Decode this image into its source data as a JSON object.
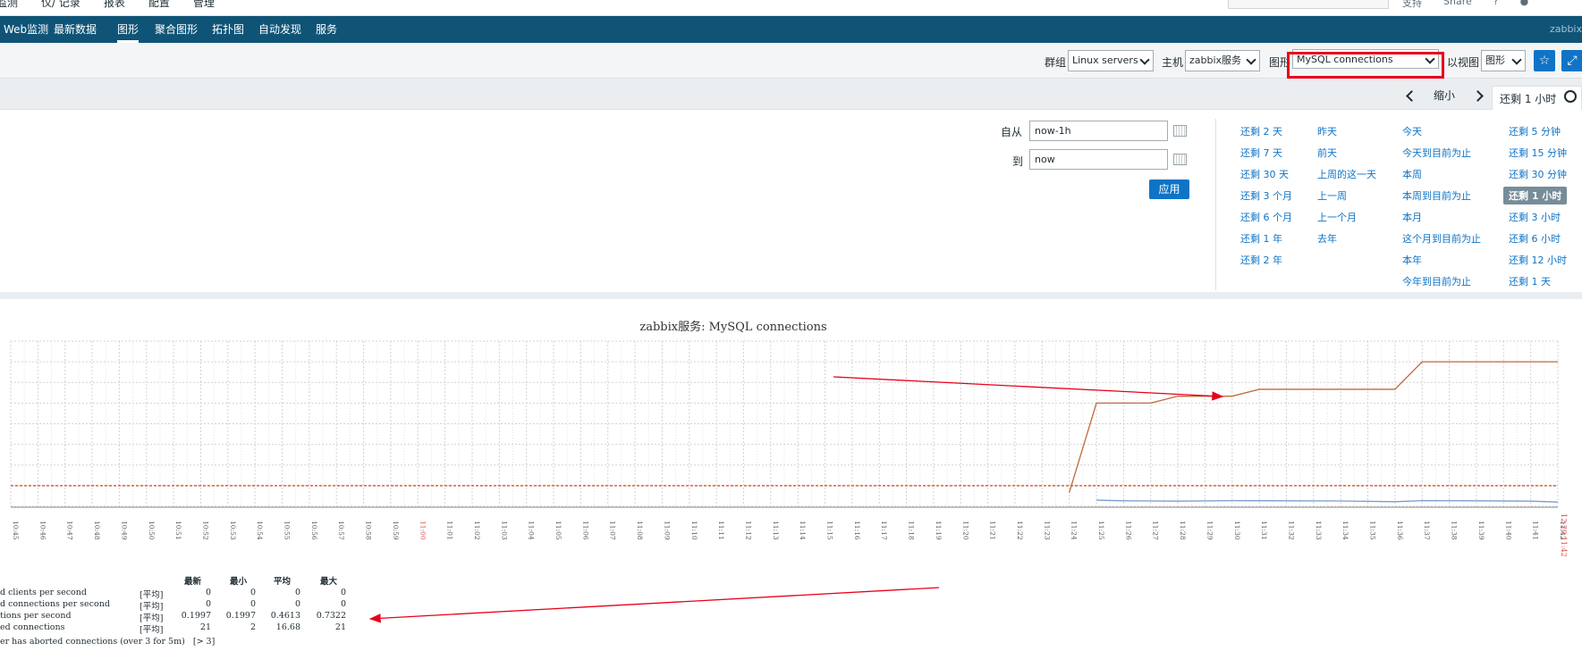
{
  "top_menu": [
    "监测",
    "仪/ 记录",
    "报表",
    "配置",
    "管理"
  ],
  "top_right": [
    "支持",
    "Share",
    "?"
  ],
  "nav": {
    "items": [
      "Web监测",
      "最新数据",
      "图形",
      "聚合图形",
      "拓扑图",
      "自动发现",
      "服务"
    ],
    "active": "图形",
    "brand": "zabbix"
  },
  "filter": {
    "group_label": "群组",
    "group_value": "Linux servers",
    "host_label": "主机",
    "host_value": "zabbix服务",
    "graph_label": "图形",
    "graph_value": "MySQL connections",
    "view_label": "以视图",
    "view_value": "图形"
  },
  "time_nav": {
    "zoom_out": "缩小",
    "active_tab": "还剩 1 小时"
  },
  "time_panel": {
    "from_label": "自从",
    "from_value": "now-1h",
    "to_label": "到",
    "to_value": "now",
    "apply": "应用",
    "quick_columns": [
      [
        "还剩 2 天",
        "还剩 7 天",
        "还剩 30 天",
        "还剩 3 个月",
        "还剩 6 个月",
        "还剩 1 年",
        "还剩 2 年"
      ],
      [
        "昨天",
        "前天",
        "上周的这一天",
        "上一周",
        "上一个月",
        "去年"
      ],
      [
        "今天",
        "今天到目前为止",
        "本周",
        "本周到目前为止",
        "本月",
        "这个月到目前为止",
        "本年",
        "今年到目前为止"
      ],
      [
        "还剩 5 分钟",
        "还剩 15 分钟",
        "还剩 30 分钟",
        "还剩 1 小时",
        "还剩 3 小时",
        "还剩 6 小时",
        "还剩 12 小时",
        "还剩 1 天"
      ]
    ],
    "selected": "还剩 1 小时"
  },
  "graph": {
    "title": "zabbix服务: MySQL connections",
    "legend_headers": [
      "最新",
      "最小",
      "平均",
      "最大"
    ],
    "legend_rows": [
      {
        "name": "d clients per second",
        "func": "[平均]",
        "last": "0",
        "min": "0",
        "avg": "0",
        "max": "0"
      },
      {
        "name": "d connections per second",
        "func": "[平均]",
        "last": "0",
        "min": "0",
        "avg": "0",
        "max": "0"
      },
      {
        "name": "tions per second",
        "func": "[平均]",
        "last": "0.1997",
        "min": "0.1997",
        "avg": "0.4613",
        "max": "0.7322"
      },
      {
        "name": "ed connections",
        "func": "[平均]",
        "last": "21",
        "min": "2",
        "avg": "16.68",
        "max": "21"
      }
    ],
    "trigger_text": "er has aborted connections (over 3 for 5m)   [> 3]",
    "end_label": "12-29 11:42",
    "colors": {
      "connections": "#c06a3c",
      "per_second": "#7a9ccf",
      "trigger": "#e06030",
      "grid": "#d3d3d3",
      "annotation": "#e8001a"
    }
  },
  "chart_data": {
    "type": "line",
    "title": "zabbix服务: MySQL connections",
    "x": [
      "10:45",
      "10:46",
      "10:47",
      "10:48",
      "10:49",
      "10:50",
      "10:51",
      "10:52",
      "10:53",
      "10:54",
      "10:55",
      "10:56",
      "10:57",
      "10:58",
      "10:59",
      "11:00",
      "11:01",
      "11:02",
      "11:03",
      "11:04",
      "11:05",
      "11:06",
      "11:07",
      "11:08",
      "11:09",
      "11:10",
      "11:11",
      "11:12",
      "11:13",
      "11:14",
      "11:15",
      "11:16",
      "11:17",
      "11:18",
      "11:19",
      "11:20",
      "11:21",
      "11:22",
      "11:23",
      "11:24",
      "11:25",
      "11:26",
      "11:27",
      "11:28",
      "11:29",
      "11:30",
      "11:31",
      "11:32",
      "11:33",
      "11:34",
      "11:35",
      "11:36",
      "11:37",
      "11:38",
      "11:39",
      "11:40",
      "11:41",
      "11:42"
    ],
    "series": [
      {
        "name": "ed connections",
        "points": [
          [
            "11:24",
            2
          ],
          [
            "11:25",
            15
          ],
          [
            "11:27",
            15
          ],
          [
            "11:28",
            16
          ],
          [
            "11:30",
            16
          ],
          [
            "11:31",
            17
          ],
          [
            "11:36",
            17
          ],
          [
            "11:37",
            21
          ],
          [
            "11:42",
            21
          ]
        ]
      },
      {
        "name": "tions per second",
        "points": [
          [
            "11:25",
            0.73
          ],
          [
            "11:26",
            0.55
          ],
          [
            "11:28",
            0.45
          ],
          [
            "11:30",
            0.6
          ],
          [
            "11:32",
            0.55
          ],
          [
            "11:34",
            0.5
          ],
          [
            "11:36",
            0.3
          ],
          [
            "11:37",
            0.6
          ],
          [
            "11:39",
            0.55
          ],
          [
            "11:41",
            0.45
          ],
          [
            "11:42",
            0.2
          ]
        ]
      }
    ],
    "trigger_threshold": 3,
    "ylim": [
      0,
      24
    ],
    "grid": true
  }
}
